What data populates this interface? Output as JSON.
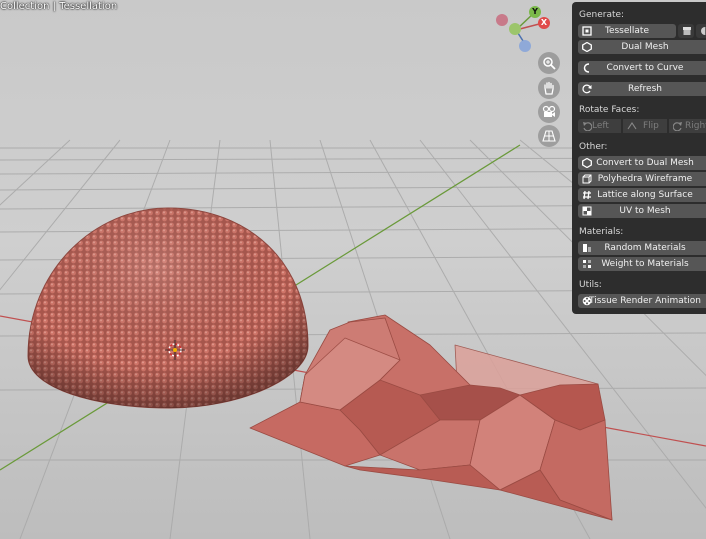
{
  "viewport": {
    "header_text": "Collection | Tessellation",
    "gizmo": {
      "x": "X",
      "y": "Y",
      "z": "Z"
    },
    "nav_buttons": [
      "zoom-icon",
      "hand-icon",
      "camera-icon",
      "grid-icon"
    ],
    "colors": {
      "mesh": "#c46a5f",
      "axis_x": "#c05050",
      "axis_y": "#6a9a3a"
    }
  },
  "panel": {
    "generate": {
      "title": "Generate:",
      "tessellate": "Tessellate",
      "dual_mesh": "Dual Mesh",
      "convert_to_curve": "Convert to Curve",
      "refresh": "Refresh"
    },
    "rotate_faces": {
      "title": "Rotate Faces:",
      "left": "Left",
      "flip": "Flip",
      "right": "Right"
    },
    "other": {
      "title": "Other:",
      "items": [
        "Convert to Dual Mesh",
        "Polyhedra Wireframe",
        "Lattice along Surface",
        "UV to Mesh"
      ]
    },
    "materials": {
      "title": "Materials:",
      "items": [
        "Random Materials",
        "Weight to Materials"
      ]
    },
    "utils": {
      "title": "Utils:",
      "items": [
        "Tissue Render Animation"
      ]
    }
  }
}
